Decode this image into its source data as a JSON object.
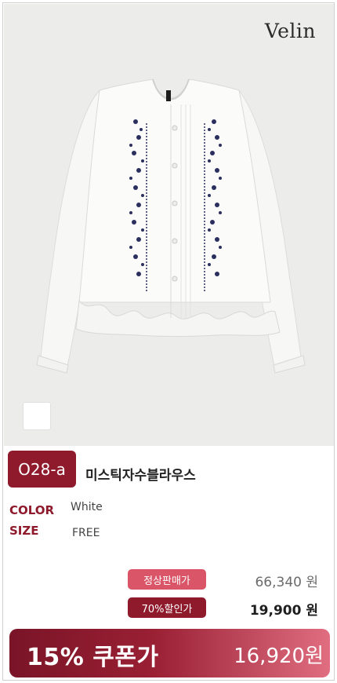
{
  "brand": {
    "logo_text": "Velin"
  },
  "product": {
    "code": "O28-a",
    "name": "미스틱자수블라우스",
    "specs": [
      {
        "label": "COLOR",
        "value": "White"
      },
      {
        "label": "SIZE",
        "value": "FREE"
      }
    ]
  },
  "pricing": {
    "regular_label": "정상판매가",
    "regular_price": "66,340 원",
    "sale_label": "70%할인가",
    "sale_price": "19,900 원"
  },
  "coupon": {
    "label": "15% 쿠폰가",
    "price": "16,920원"
  },
  "colors": {
    "accent": "#8e1a2c",
    "accent_light": "#d95567",
    "photo_bg": "#ececea",
    "embroidery": "#2a2f5e"
  },
  "icons": {
    "swatch": "color-swatch-white"
  }
}
